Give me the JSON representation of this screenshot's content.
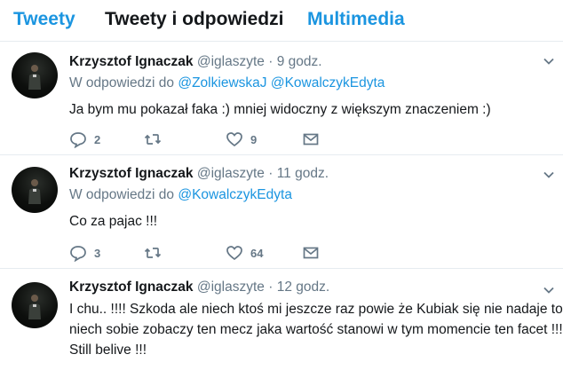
{
  "tabs": [
    {
      "label": "Tweety",
      "active": false
    },
    {
      "label": "Tweety i odpowiedzi",
      "active": true
    },
    {
      "label": "Multimedia",
      "active": false
    }
  ],
  "tweets": [
    {
      "name": "Krzysztof Ignaczak",
      "handle": "@iglaszyte",
      "dot": "·",
      "time": "9 godz.",
      "reply_prefix": "W odpowiedzi do",
      "reply_to": [
        "@ZolkiewskaJ",
        "@KowalczykEdyta"
      ],
      "lines": [
        "Ja bym mu pokazał faka :) mniej widoczny  z większym znaczeniem :)"
      ],
      "replies": "2",
      "retweets": "",
      "likes": "9"
    },
    {
      "name": "Krzysztof Ignaczak",
      "handle": "@iglaszyte",
      "dot": "·",
      "time": "11 godz.",
      "reply_prefix": "W odpowiedzi do",
      "reply_to": [
        "@KowalczykEdyta"
      ],
      "lines": [
        "Co za pajac !!!"
      ],
      "replies": "3",
      "retweets": "",
      "likes": "64"
    },
    {
      "name": "Krzysztof Ignaczak",
      "handle": "@iglaszyte",
      "dot": "·",
      "time": "12 godz.",
      "reply_prefix": "",
      "reply_to": [],
      "lines": [
        "I chu.. !!!! Szkoda ale niech ktoś mi jeszcze raz powie że Kubiak się nie nadaje to",
        "niech sobie zobaczy ten mecz jaka wartość stanowi w tym momencie ten facet !!!",
        "Still belive !!!"
      ],
      "replies": "",
      "retweets": "",
      "likes": ""
    }
  ],
  "colors": {
    "accent": "#1b95e0",
    "secondary": "#657786",
    "text": "#14171a"
  }
}
